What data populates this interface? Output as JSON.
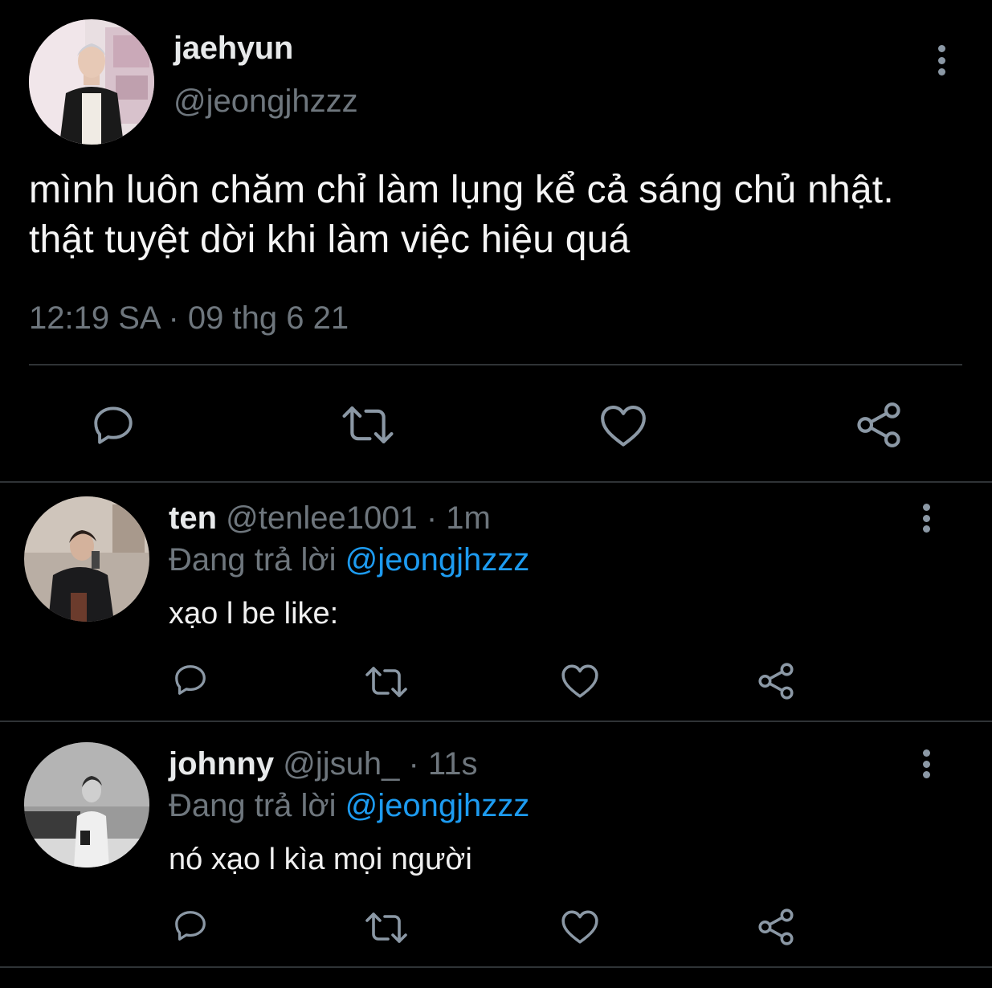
{
  "main": {
    "name": "jaehyun",
    "handle": "@jeongjhzzz",
    "text": "mình luôn chăm chỉ làm lụng kể cả sáng chủ nhật. thật tuyệt dời khi làm việc hiệu quá",
    "timestamp": "12:19 SA · 09 thg 6 21"
  },
  "replies": [
    {
      "name": "ten",
      "handle": "@tenlee1001",
      "dot": "·",
      "time": "1m",
      "replying_prefix": "Đang trả lời",
      "replying_to": "@jeongjhzzz",
      "text": "xạo l be like:"
    },
    {
      "name": "johnny",
      "handle": "@jjsuh_",
      "dot": "·",
      "time": "11s",
      "replying_prefix": "Đang trả lời",
      "replying_to": "@jeongjhzzz",
      "text": "nó xạo l kìa mọi người"
    }
  ],
  "icons": [
    "reply-icon",
    "retweet-icon",
    "like-icon",
    "share-icon",
    "more-icon"
  ],
  "colors": {
    "background": "#000000",
    "text": "#e7e9ea",
    "muted": "#6e767d",
    "accent": "#1d9bf0",
    "divider": "#2f3336",
    "icon": "#8b98a5"
  }
}
